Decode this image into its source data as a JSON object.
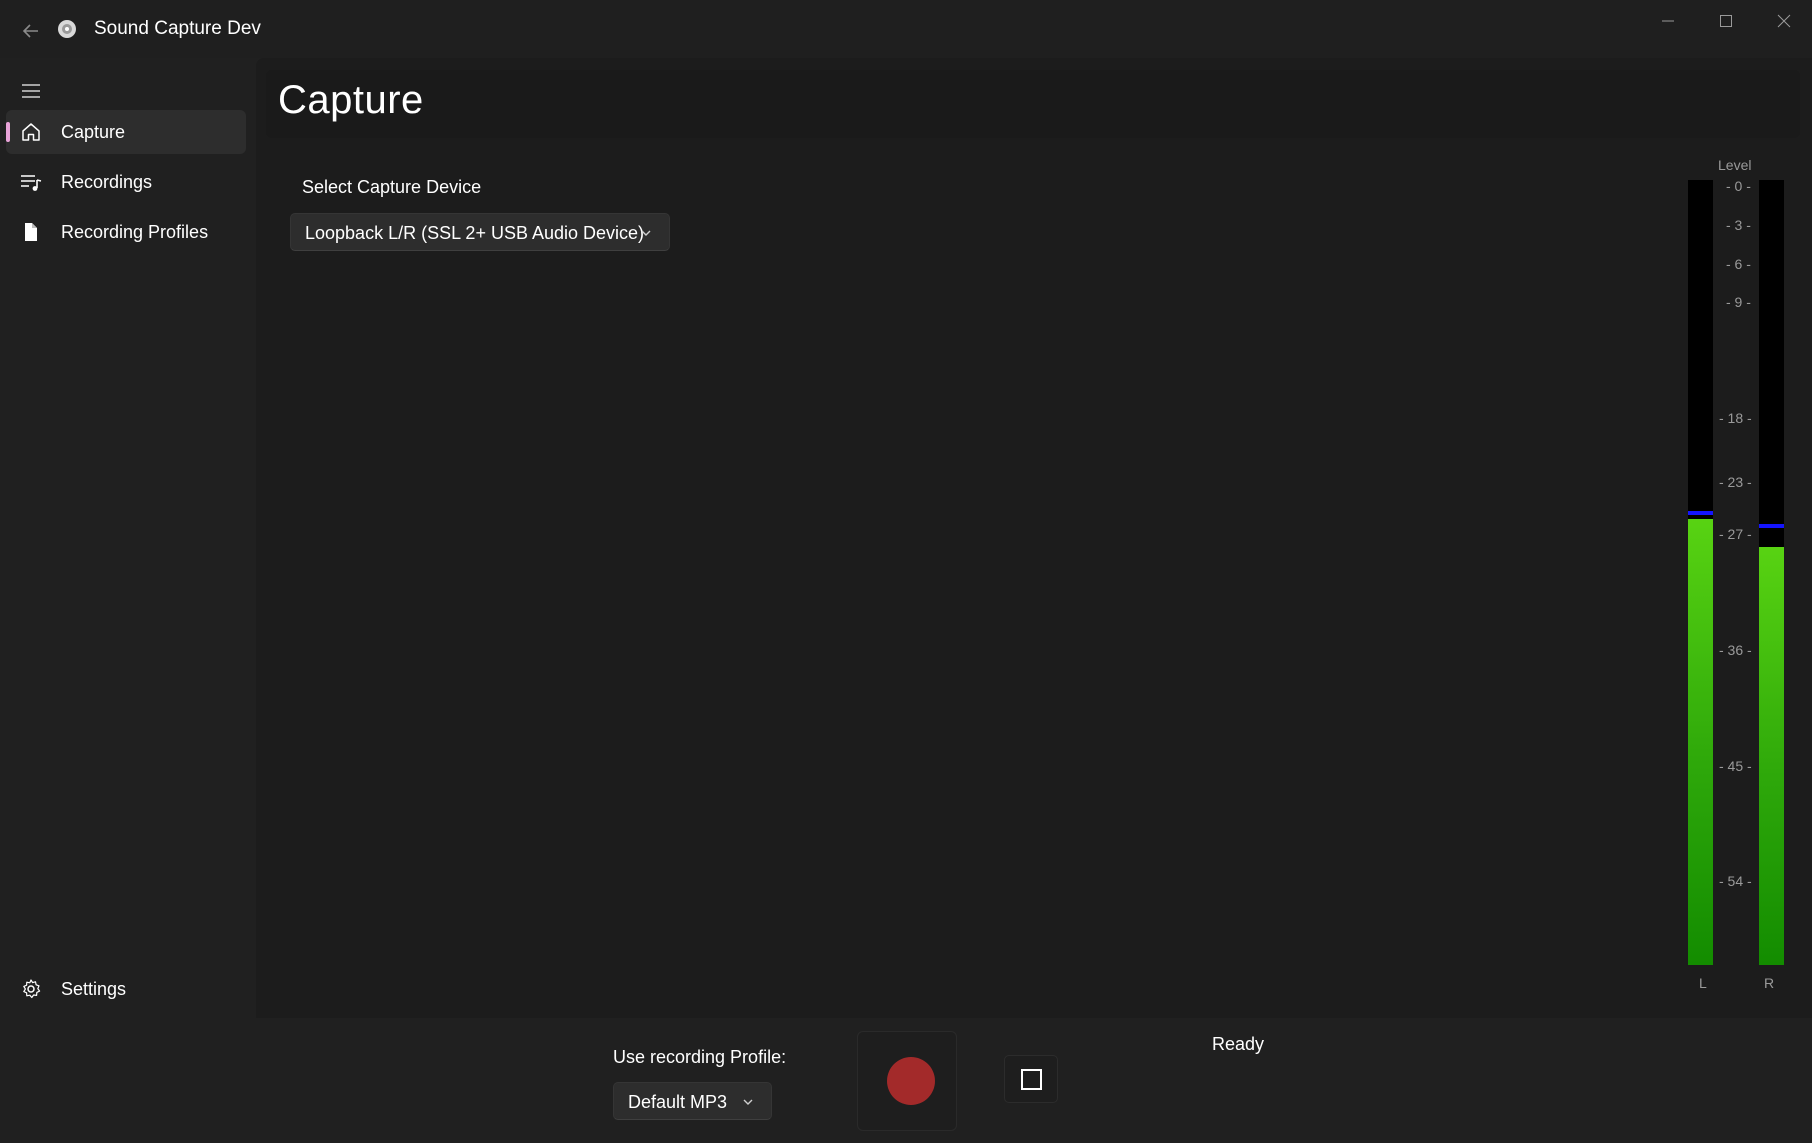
{
  "window": {
    "title": "Sound Capture Dev"
  },
  "nav": {
    "items": [
      {
        "label": "Capture",
        "icon": "home-icon",
        "selected": true
      },
      {
        "label": "Recordings",
        "icon": "music-list-icon",
        "selected": false
      },
      {
        "label": "Recording Profiles",
        "icon": "document-icon",
        "selected": false
      }
    ],
    "footer": {
      "label": "Settings",
      "icon": "gear-icon"
    }
  },
  "page": {
    "title": "Capture",
    "device_label": "Select Capture Device",
    "device_value": "Loopback L/R (SSL 2+ USB Audio Device)"
  },
  "meters": {
    "title": "Level",
    "scale": [
      "- 0 -",
      "- 3 -",
      "- 6 -",
      "- 9 -",
      "- 18 -",
      "- 23 -",
      "- 27 -",
      "- 36 -",
      "- 45 -",
      "- 54 -"
    ],
    "left_label": "L",
    "right_label": "R",
    "left_level_fraction": 0.568,
    "right_level_fraction": 0.532,
    "left_peak_fraction": 0.573,
    "right_peak_fraction": 0.557,
    "fill_color": "#2ea80a",
    "peak_color": "#1414ff"
  },
  "bottom": {
    "profile_label": "Use recording Profile:",
    "profile_value": "Default MP3",
    "record_color": "#a32a2a",
    "status": "Ready"
  },
  "colors": {
    "accent": "#e8a3d8",
    "background": "#202020"
  }
}
